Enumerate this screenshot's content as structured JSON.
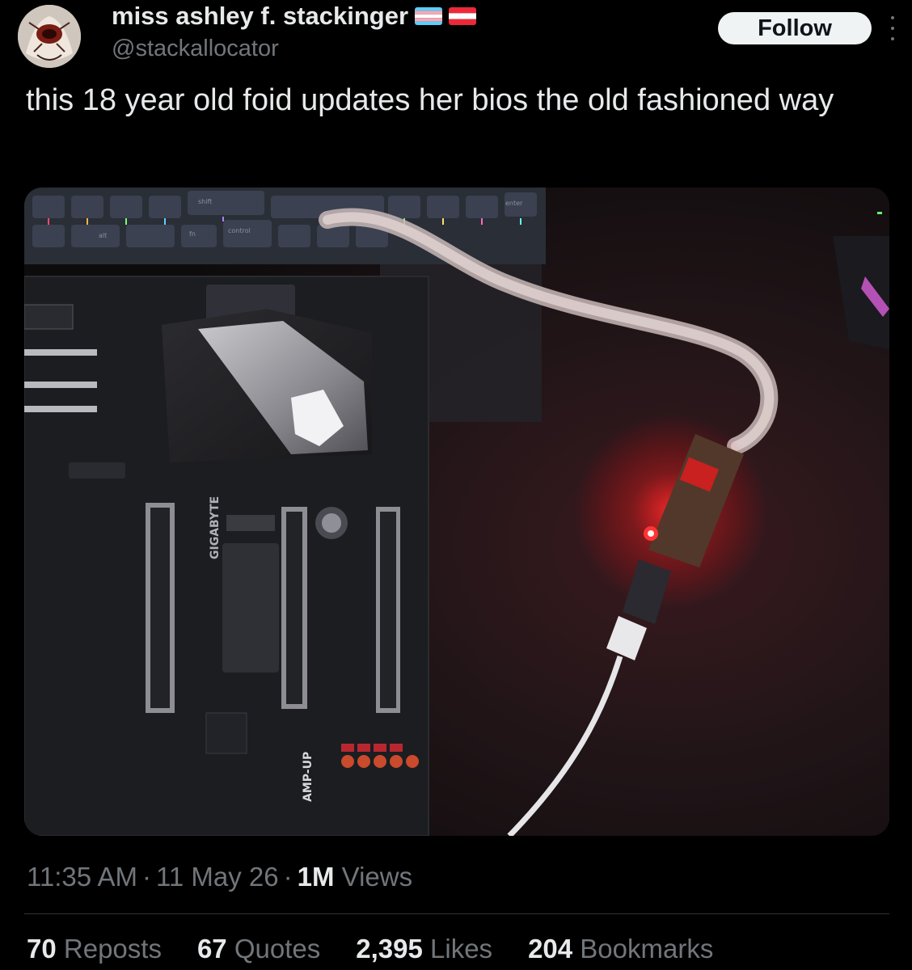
{
  "author": {
    "display_name": "miss ashley f. stackinger",
    "handle": "@stackallocator",
    "flags": [
      "transgender-flag",
      "austria-flag"
    ]
  },
  "follow_label": "Follow",
  "tweet": {
    "text": "this 18 year old foid updates her bios the old fashioned way"
  },
  "media": {
    "key_labels": [
      "shift",
      "control",
      "alt",
      "fn",
      "enter"
    ],
    "board_labels": [
      "GIGABYTE",
      "AMP-UP"
    ]
  },
  "meta": {
    "time": "11:35 AM",
    "date": "11 May 26",
    "views_count": "1M",
    "views_label": "Views"
  },
  "stats": {
    "reposts": {
      "count": "70",
      "label": "Reposts"
    },
    "quotes": {
      "count": "67",
      "label": "Quotes"
    },
    "likes": {
      "count": "2,395",
      "label": "Likes"
    },
    "bookmarks": {
      "count": "204",
      "label": "Bookmarks"
    }
  },
  "colors": {
    "background": "#000000",
    "text_primary": "#e7e9ea",
    "text_secondary": "#71767b",
    "follow_bg": "#eff3f4",
    "divider": "#2f3336"
  }
}
